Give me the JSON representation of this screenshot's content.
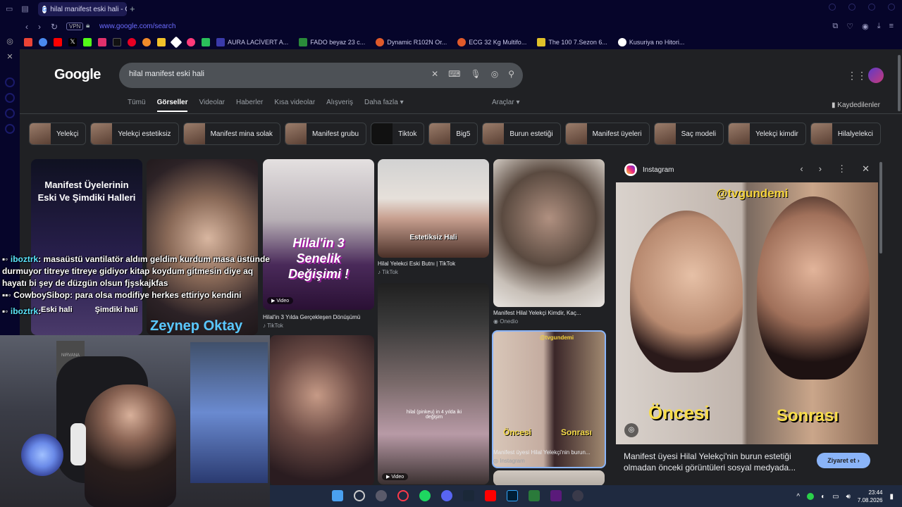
{
  "browser": {
    "tab_title": "hilal manifest eski hali - Go",
    "new_tab": "+",
    "vpn": "VPN",
    "url": "www.google.com/search",
    "bookmarks": [
      {
        "label": "AURA LACİVERT A...",
        "color": "#3a3aaa"
      },
      {
        "label": "FADO beyaz 23 c...",
        "color": "#2a8a3a"
      },
      {
        "label": "Dynamic R102N Or...",
        "color": "#e05a2a"
      },
      {
        "label": "ECG 32 Kg Multifo...",
        "color": "#e05a2a"
      },
      {
        "label": "The 100 7.Sezon 6...",
        "color": "#e0c02a"
      },
      {
        "label": "Kusuriya no Hitori...",
        "color": "#ffffff"
      }
    ]
  },
  "google": {
    "logo": "Google",
    "query": "hilal manifest eski hali",
    "tabs": [
      "Tümü",
      "Görseller",
      "Videolar",
      "Haberler",
      "Kısa videolar",
      "Alışveriş",
      "Daha fazla"
    ],
    "active_tab": "Görseller",
    "tools": "Araçlar",
    "saved": "Kaydedilenler",
    "chips": [
      "Yelekçi",
      "Yelekçi estetiksiz",
      "Manifest mina solak",
      "Manifest grubu",
      "Tiktok",
      "Big5",
      "Burun estetiği",
      "Manifest üyeleri",
      "Saç modeli",
      "Yelekçi kimdir",
      "Hilalyelekci"
    ]
  },
  "results": {
    "r1_title": "Manifest Üyelerinin Eski Ve Şimdiki Halleri",
    "r3_overlay": "Hilal'in 3 Senelik Değişimi !",
    "r3_caption": "Hilal'in 3 Yılda Gerçekleşen Dönüşümü",
    "r3_source": "TikTok",
    "r3_badge": "Video",
    "r4_overlay": "Estetiksiz Hali",
    "r4_caption": "Hilal Yelekci Eski Butnı | TikTok",
    "r4_source": "TikTok",
    "r5_caption": "Manifest Hilal Yelekçi Kimdir, Kaç...",
    "r5_source": "Onedio",
    "r6_overlay": "hilal (pinkeu) in 4 yılda iki değişim",
    "r6_badge": "Video",
    "r7_watermark": "@tvgundemi",
    "r7_left": "Öncesi",
    "r7_right": "Sonrası",
    "r7_caption": "Manifest üyesi Hilal Yelekçi'nin burun...",
    "r7_source": "Instagram",
    "r2_overlay": "Zeynep Oktay"
  },
  "preview": {
    "source": "Instagram",
    "watermark": "@tvgundemi",
    "label_left": "Öncesi",
    "label_right": "Sonrası",
    "description": "Manifest üyesi Hilal Yelekçi'nin burun estetiği olmadan önceki görüntüleri sosyal medyada...",
    "visit": "Ziyaret et ›"
  },
  "chat": [
    {
      "user": "iboztrk",
      "text": ": masaüstü vantilatör aldım geldim kurdum masa üstünde durmuyor titreye titreye gidiyor kitap koydum gitmesin diye aq hayatı bi şey de düzgün olsun fjşskajkfas"
    },
    {
      "user": "CowboySibop",
      "text": ": para olsa modifiye herkes ettiriyo kendini"
    },
    {
      "user": "iboztrk",
      "text": ":"
    }
  ],
  "stream_labels": {
    "left": "Eski hali",
    "right": "Şimdiki hali"
  },
  "webcam": {
    "poster": "NIRVANA"
  },
  "taskbar": {
    "time": "23:44",
    "date": "7.08.2026"
  }
}
